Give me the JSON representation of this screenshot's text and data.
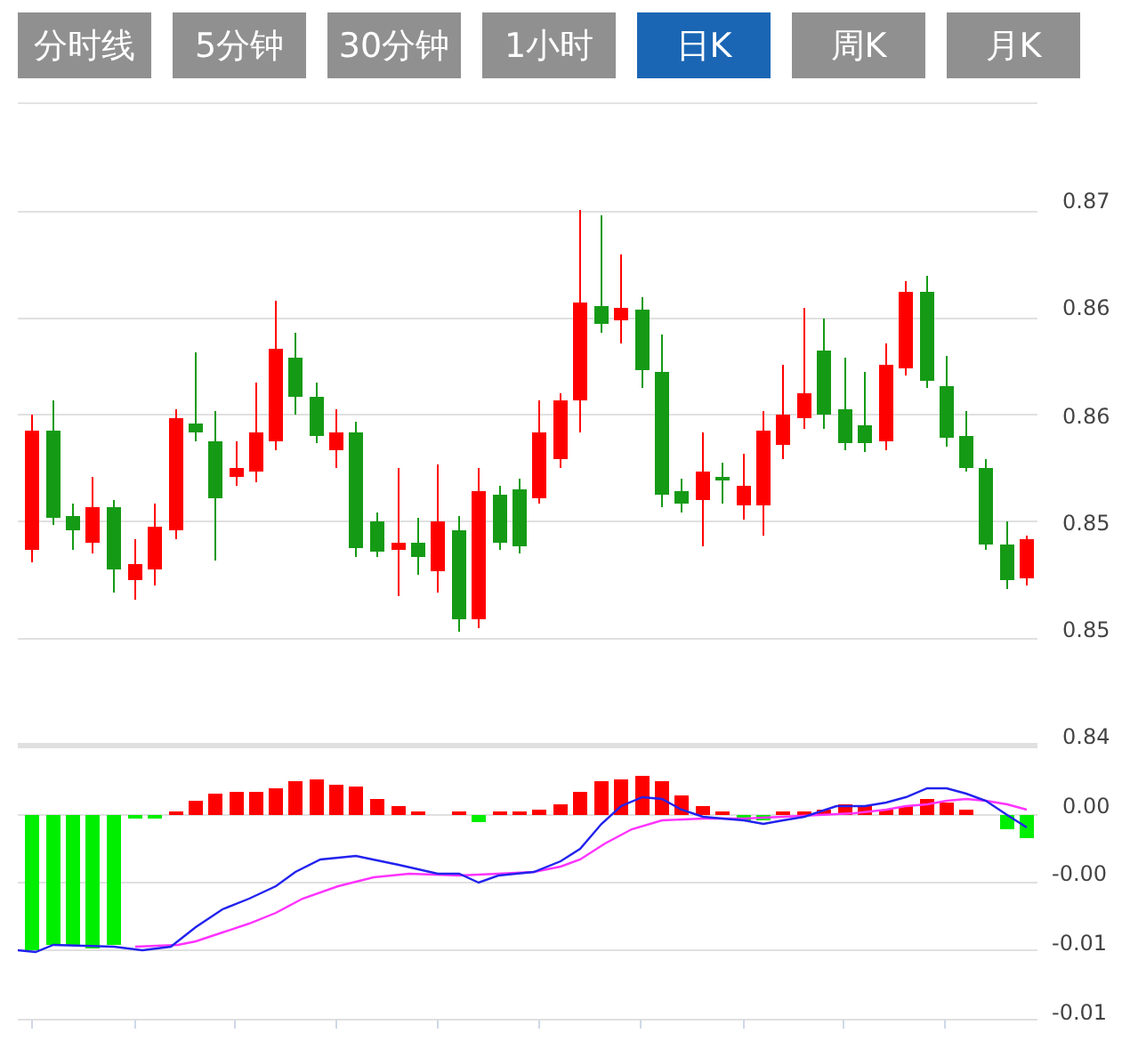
{
  "tabs": [
    {
      "label": "分时线",
      "selected": false
    },
    {
      "label": "5分钟",
      "selected": false
    },
    {
      "label": "30分钟",
      "selected": false
    },
    {
      "label": "1小时",
      "selected": false
    },
    {
      "label": "日K",
      "selected": true
    },
    {
      "label": "周K",
      "selected": false
    },
    {
      "label": "月K",
      "selected": false
    }
  ],
  "price_axis": {
    "labels": [
      "0.87",
      "0.86",
      "0.86",
      "0.85",
      "0.85",
      "0.84"
    ]
  },
  "macd_axis": {
    "labels": [
      "0.00",
      "-0.00",
      "-0.01",
      "-0.01"
    ]
  }
}
